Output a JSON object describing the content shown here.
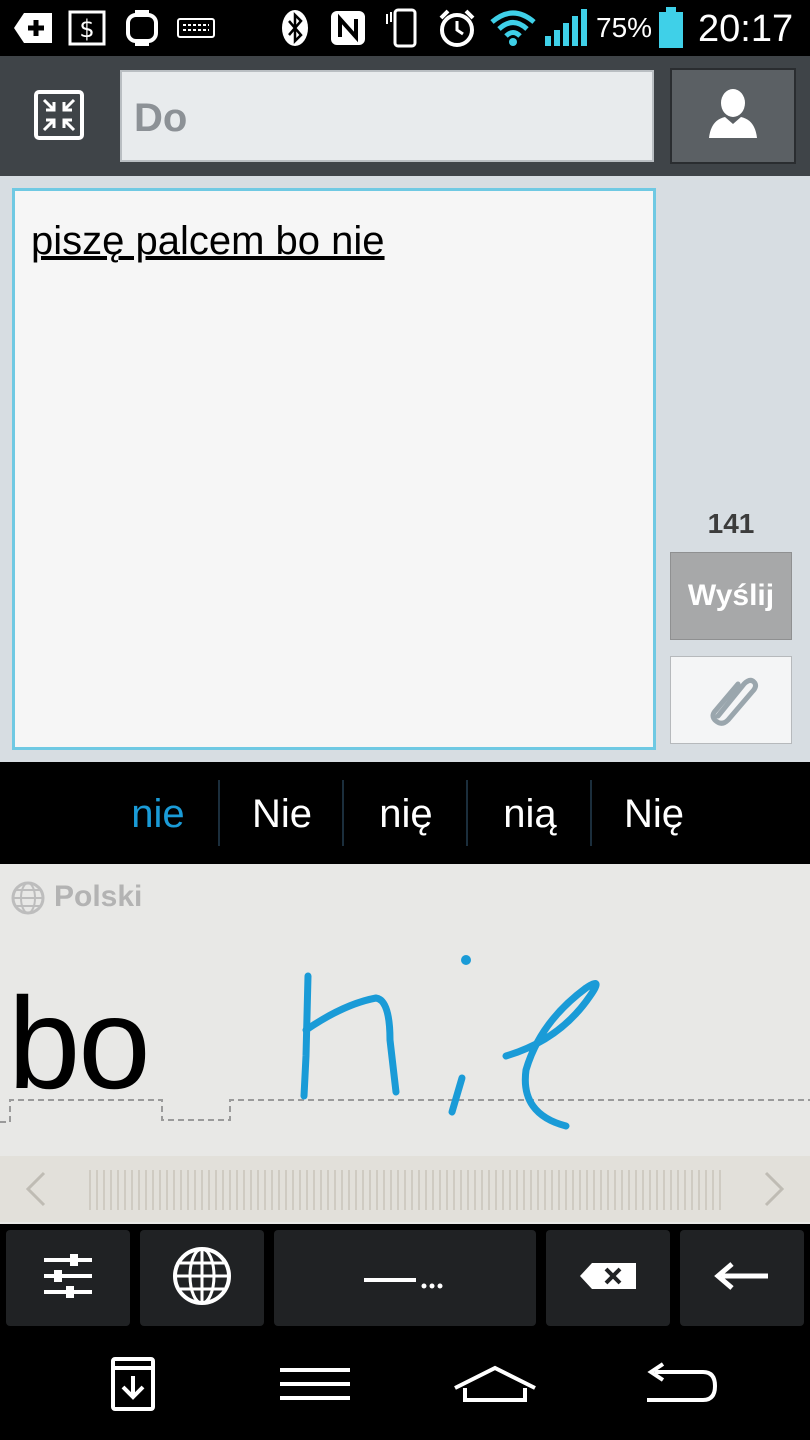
{
  "status_bar": {
    "battery_percent": "75%",
    "time": "20:17",
    "icons": [
      "add-icon",
      "dollar-card-icon",
      "watch-icon",
      "keyboard-icon",
      "bluetooth-icon",
      "nfc-icon",
      "vibrate-icon",
      "alarm-icon",
      "wifi-icon",
      "signal-icon",
      "battery-icon"
    ]
  },
  "header": {
    "to_placeholder": "Do",
    "icons": [
      "collapse-icon",
      "contact-icon"
    ]
  },
  "compose": {
    "message_text": "piszę palcem bo nie",
    "char_count": "141",
    "send_label": "Wyślij",
    "icons": [
      "attach-icon"
    ]
  },
  "suggestions": {
    "items": [
      "nie",
      "Nie",
      "nię",
      "nią",
      "Nię"
    ],
    "selected_index": 0,
    "selected_color": "#1a9bd7"
  },
  "handwriting": {
    "language": "Polski",
    "recognized_word": "bo",
    "ink_color": "#1a9bd7",
    "icons": [
      "globe-icon",
      "chevron-left-icon",
      "chevron-right-icon"
    ]
  },
  "keyboard": {
    "keys": [
      "settings-icon",
      "globe-icon",
      "space-icon",
      "backspace-icon",
      "enter-icon"
    ]
  },
  "navbar": {
    "buttons": [
      "download-box-icon",
      "menu-icon",
      "home-icon",
      "back-icon"
    ]
  }
}
